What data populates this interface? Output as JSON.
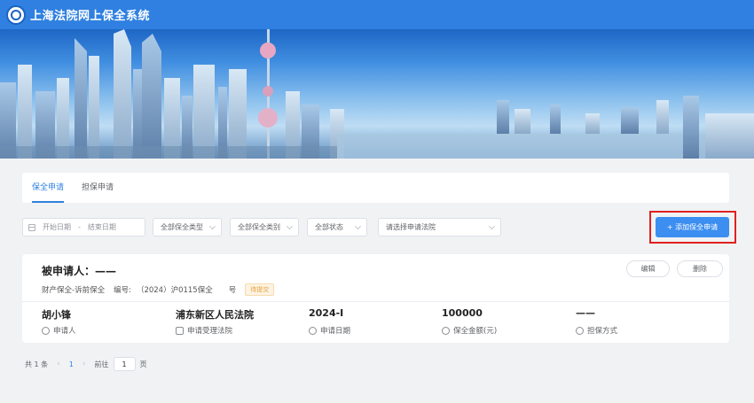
{
  "header": {
    "title": "上海法院网上保全系统"
  },
  "tabs": [
    {
      "label": "保全申请",
      "active": true
    },
    {
      "label": "担保申请",
      "active": false
    }
  ],
  "filters": {
    "start_date_placeholder": "开始日期",
    "date_separator": "-",
    "end_date_placeholder": "结束日期",
    "preservation_type": "全部保全类型",
    "preservation_category": "全部保全类别",
    "status": "全部状态",
    "court_placeholder": "请选择申请法院"
  },
  "add_button_label": "+ 添加保全申请",
  "record": {
    "respondent_label": "被申请人：——",
    "type": "财产保全-诉前保全",
    "number_label": "编号:",
    "number_value": "（2024）沪0115保全",
    "number_suffix": "号",
    "status_tag": "待提交",
    "edit_label": "编辑",
    "delete_label": "删除",
    "fields": [
      {
        "value": "胡小锋",
        "label": "申请人",
        "icon": "user-icon"
      },
      {
        "value": "浦东新区人民法院",
        "label": "申请受理法院",
        "icon": "court-icon"
      },
      {
        "value": "2024-I",
        "label": "申请日期",
        "icon": "clock-icon"
      },
      {
        "value": "100000",
        "label": "保全金额(元)",
        "icon": "yen-icon"
      },
      {
        "value": "——",
        "label": "担保方式",
        "icon": "guarantee-icon"
      }
    ]
  },
  "pagination": {
    "total": "共 1 条",
    "prev": "‹",
    "current": "1",
    "next": "›",
    "goto_label": "前往",
    "goto_value": "1",
    "page_suffix": "页"
  },
  "colors": {
    "primary": "#2f80e0",
    "button": "#3c8ef0",
    "highlight": "#e02020",
    "status": "#e6a23c"
  }
}
